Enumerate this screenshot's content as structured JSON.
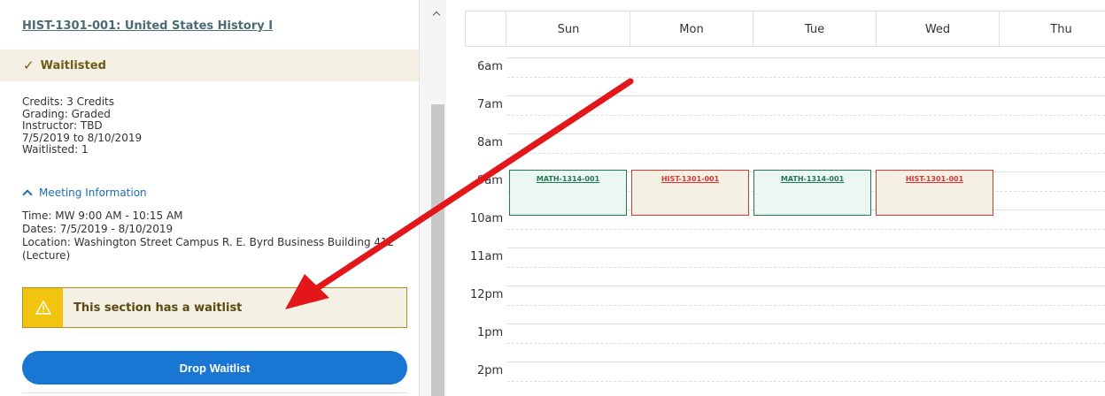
{
  "left_panel": {
    "course_title": "HIST-1301-001: United States History I",
    "status": {
      "icon": "check-icon",
      "label": "Waitlisted"
    },
    "details": {
      "credits": "Credits: 3 Credits",
      "grading": "Grading: Graded",
      "instructor": "Instructor: TBD",
      "dates": "7/5/2019 to 8/10/2019",
      "waitlisted": "Waitlisted:  1"
    },
    "meeting_toggle": "Meeting Information",
    "meeting": {
      "time": "Time: MW 9:00 AM - 10:15 AM",
      "dates": "Dates: 7/5/2019 - 8/10/2019",
      "location": "Location: Washington Street Campus R. E. Byrd Business Building 412 (Lecture)"
    },
    "warning": {
      "icon": "warning-icon",
      "text": "This section has a waitlist"
    },
    "drop_button": "Drop Waitlist"
  },
  "calendar": {
    "days": [
      "Sun",
      "Mon",
      "Tue",
      "Wed",
      "Thu"
    ],
    "times": [
      "6am",
      "7am",
      "8am",
      "9am",
      "10am",
      "11am",
      "12pm",
      "1pm",
      "2pm"
    ],
    "events": [
      {
        "label": "MATH-1314-001",
        "kind": "math"
      },
      {
        "label": "HIST-1301-001",
        "kind": "hist"
      },
      {
        "label": "MATH-1314-001",
        "kind": "math"
      },
      {
        "label": "HIST-1301-001",
        "kind": "hist"
      }
    ]
  },
  "colors": {
    "primary_button": "#1976d2",
    "waitlist_bg": "#f4f0e3",
    "warning_icon_bg": "#f1c40f",
    "math_event": "#1f7a54",
    "hist_event": "#dd3333",
    "annotation_arrow": "#e3161a"
  }
}
